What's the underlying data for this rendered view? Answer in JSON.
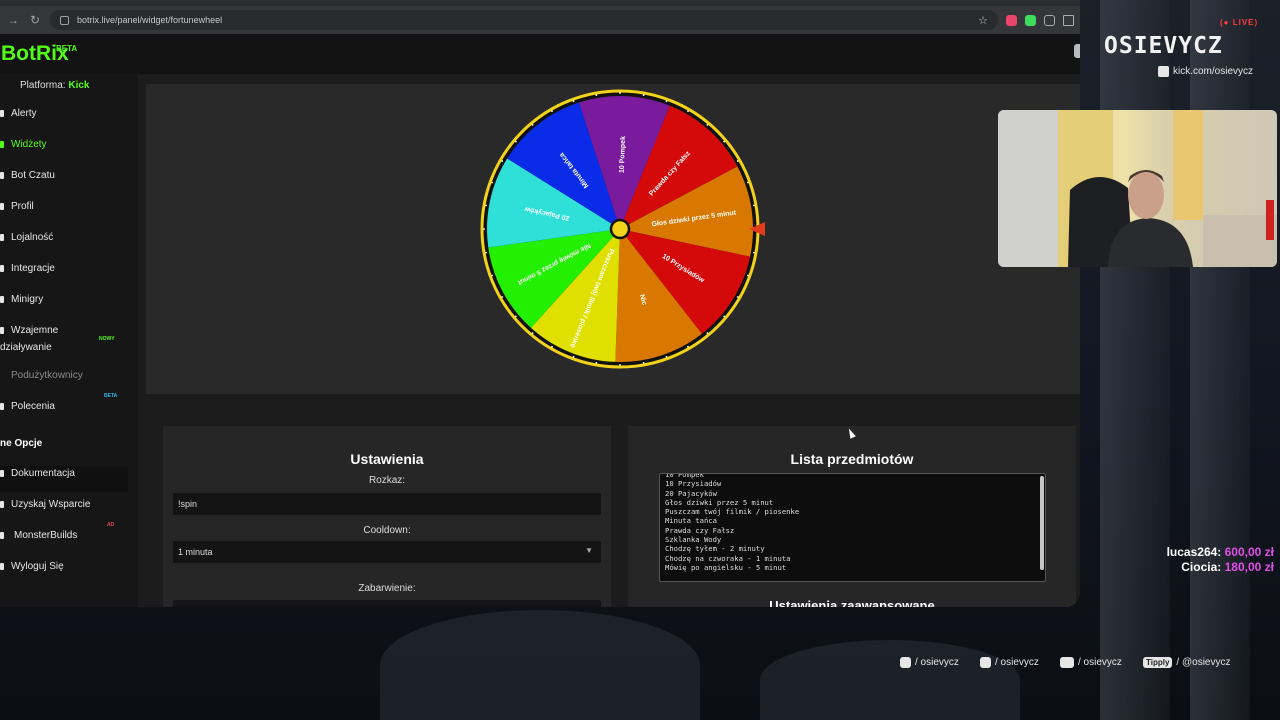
{
  "browser": {
    "url": "botrix.live/panel/widget/fortunewheel"
  },
  "app": {
    "logo": "BotRix",
    "logo_badge": "BETA",
    "platform_label": "Platforma:",
    "platform_value": "Kick"
  },
  "sidebar": {
    "items": [
      {
        "label": "Alerty"
      },
      {
        "label": "Widżety"
      },
      {
        "label": "Bot Czatu"
      },
      {
        "label": "Profil"
      },
      {
        "label": "Lojalność"
      },
      {
        "label": "Integracje"
      },
      {
        "label": "Minigry"
      },
      {
        "label": "Wzajemne",
        "label2": "działywanie",
        "badge": "NOWY"
      },
      {
        "label": "Podużytkownicy"
      },
      {
        "label": "Polecenia",
        "badge": "BETA"
      },
      {
        "label": "ne Opcje"
      },
      {
        "label": "Dokumentacja"
      },
      {
        "label": "Uzyskaj Wsparcie"
      },
      {
        "label": "MonsterBuilds",
        "badge": "AD"
      },
      {
        "label": "Wyloguj Się"
      }
    ]
  },
  "wheel": {
    "segments": [
      {
        "label": "10 Pompek",
        "color": "#7a1b9e"
      },
      {
        "label": "Prawda czy Fałsz",
        "color": "#d40a0a"
      },
      {
        "label": "Głos dziwki przez 5 minut",
        "color": "#d87800"
      },
      {
        "label": "10 Przysiadów",
        "color": "#d40a0a"
      },
      {
        "label": "Nic",
        "color": "#d87800"
      },
      {
        "label": "Puszczam twój filmik / piosenkę",
        "color": "#dfe000"
      },
      {
        "label": "Nie mówię przez 5 minut",
        "color": "#22f000"
      },
      {
        "label": "20 Pajacyków",
        "color": "#2ee0d8"
      },
      {
        "label": "Minuta tańca",
        "color": "#0a2ce8"
      }
    ],
    "rim_color": "#f2d21a",
    "pointer_color": "#e23b1c"
  },
  "settings": {
    "title": "Ustawienia",
    "command_label": "Rozkaz:",
    "command_value": "!spin",
    "cooldown_label": "Cooldown:",
    "cooldown_value": "1 minuta",
    "color_label": "Zabarwienie:"
  },
  "items_list": {
    "title": "Lista przedmiotów",
    "lines": [
      "10 Pompek",
      "10 Przysiadów",
      "20 Pajacyków",
      "Głos dziwki przez 5 minut",
      "Puszczam twój filmik / piosenke",
      "Minuta tańca",
      "Prawda czy Fałsz",
      "Szklanka Wody",
      "Chodzę tyłem - 2 minuty",
      "Chodzę na czworaka - 1 minuta",
      "Mówię po angielsku - 5 minut"
    ],
    "next_heading": "Ustawienia zaawansowane"
  },
  "overlay": {
    "live": "LIVE",
    "streamer": "OSIEVYCZ",
    "kick_url": "kick.com/osievycz",
    "donations": [
      {
        "name": "lucas264:",
        "amount": "600,00 zł"
      },
      {
        "name": "Ciocia:",
        "amount": "180,00 zł"
      }
    ],
    "socials": [
      {
        "icon": "instagram-icon",
        "text": "/ osievycz"
      },
      {
        "icon": "tiktok-icon",
        "text": "/ osievycz"
      },
      {
        "icon": "youtube-icon",
        "text": "/ osievycz"
      },
      {
        "icon": "tipply-logo",
        "badge": "Tipply",
        "text": "/ @osievycz"
      }
    ]
  }
}
